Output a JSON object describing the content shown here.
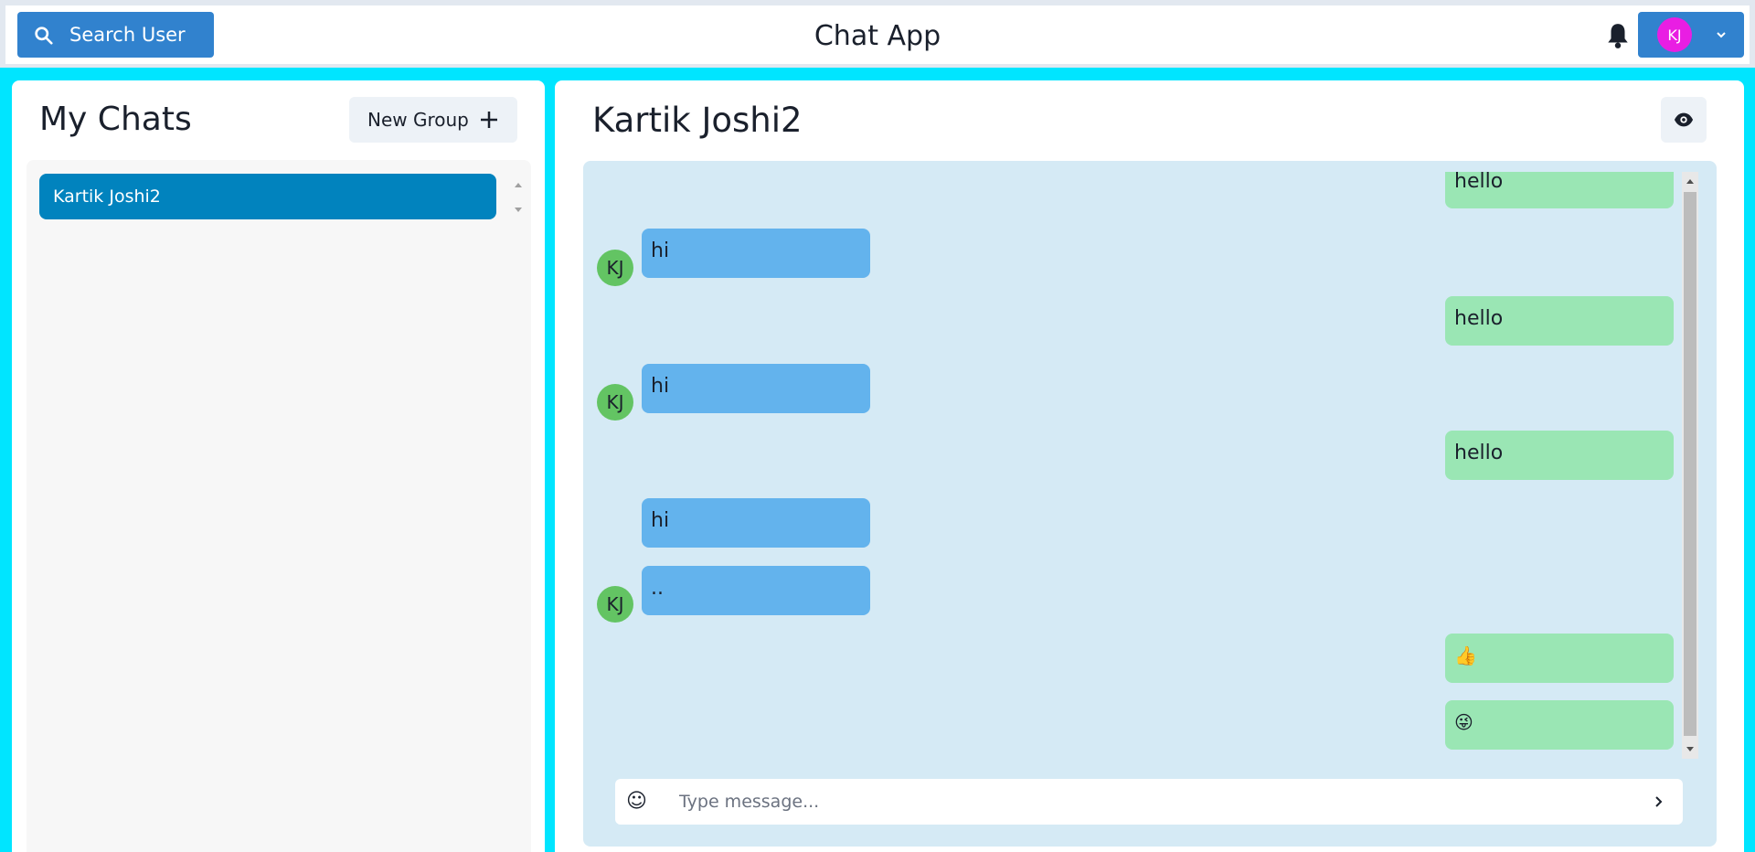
{
  "header": {
    "search_label": "Search User",
    "app_title": "Chat App",
    "user_initials": "KJ"
  },
  "sidebar": {
    "title": "My Chats",
    "new_group_label": "New Group",
    "chats": [
      {
        "name": "Kartik Joshi2",
        "selected": true
      }
    ]
  },
  "conversation": {
    "title": "Kartik Joshi2",
    "messages": [
      {
        "from": "me",
        "text": "hello"
      },
      {
        "from": "them",
        "text": "hi",
        "avatar": "KJ"
      },
      {
        "from": "me",
        "text": "hello"
      },
      {
        "from": "them",
        "text": "hi",
        "avatar": "KJ"
      },
      {
        "from": "me",
        "text": "hello"
      },
      {
        "from": "them",
        "text": "hi"
      },
      {
        "from": "them",
        "text": "..",
        "avatar": "KJ"
      },
      {
        "from": "me",
        "text": "👍"
      },
      {
        "from": "me",
        "text": "😜"
      }
    ]
  },
  "composer": {
    "emoji_icon": "☺",
    "placeholder": "Type message..."
  },
  "colors": {
    "page_background": "#00e5ff",
    "primary": "#3182ce",
    "selected_chat": "#0183be",
    "received_bubble": "#63b3ed",
    "sent_bubble": "#9ae6b4",
    "avatar_green": "#63c463",
    "profile_avatar": "#e91ee3"
  }
}
